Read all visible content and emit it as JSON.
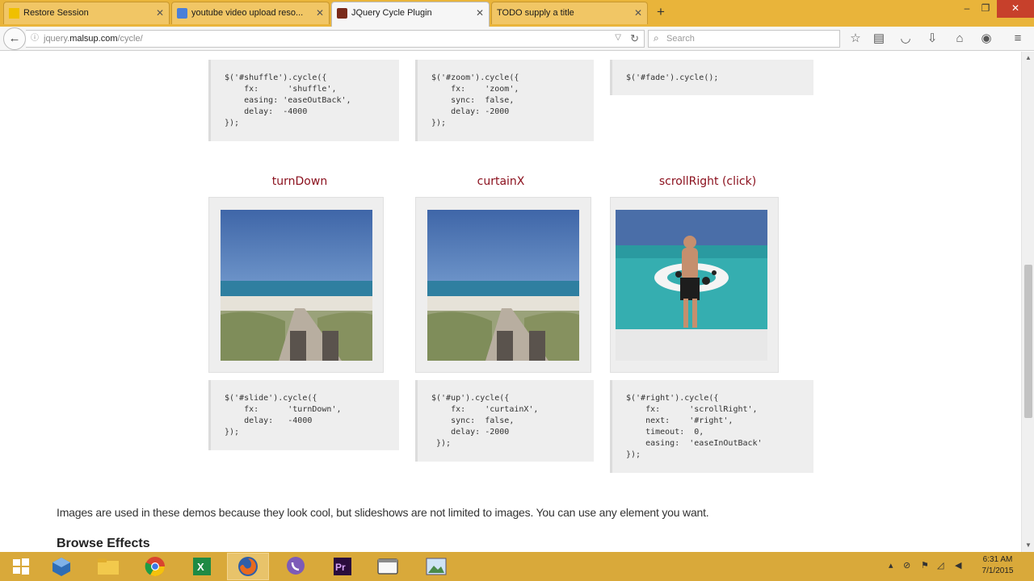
{
  "tabs": [
    {
      "label": "Restore Session",
      "icon": "warning-icon"
    },
    {
      "label": "youtube video upload reso...",
      "icon": "google-icon"
    },
    {
      "label": "JQuery Cycle Plugin",
      "icon": "page-icon"
    },
    {
      "label": "TODO supply a title",
      "icon": "blank-icon"
    }
  ],
  "nav": {
    "url_prefix": "jquery.",
    "url_domain": "malsup.com",
    "url_path": "/cycle/",
    "search_placeholder": "Search"
  },
  "top_code": [
    {
      "selector": "$('#shuffle').cycle({",
      "lines": [
        "    fx:      'shuffle',",
        "    easing: 'easeOutBack',",
        "    delay:  -4000",
        "});"
      ]
    },
    {
      "selector": "$('#zoom').cycle({",
      "lines": [
        "    fx:    'zoom',",
        "    sync:  false,",
        "    delay: -2000",
        "});"
      ]
    },
    {
      "selector": "$('#fade').cycle();",
      "lines": []
    }
  ],
  "demos": [
    {
      "title": "turnDown",
      "code": [
        "$('#slide').cycle({",
        "    fx:      'turnDown',",
        "    delay:   -4000",
        "});"
      ]
    },
    {
      "title": "curtainX",
      "code": [
        "$('#up').cycle({",
        "    fx:    'curtainX',",
        "    sync:  false,",
        "    delay: -2000",
        " });"
      ]
    },
    {
      "title": "scrollRight (click)",
      "code": [
        "$('#right').cycle({",
        "    fx:      'scrollRight',",
        "    next:    '#right',",
        "    timeout:  0,",
        "    easing:  'easeInOutBack'",
        "});"
      ]
    }
  ],
  "content": {
    "paragraph": "Images are used in these demos because they look cool, but slideshows are not limited to images.  You can use any element you want.",
    "heading": "Browse Effects"
  },
  "taskbar": {
    "apps": [
      "start-icon",
      "virtualbox-icon",
      "file-explorer-icon",
      "chrome-icon",
      "excel-icon",
      "firefox-icon",
      "viber-icon",
      "premiere-icon",
      "window-icon",
      "photos-icon"
    ],
    "time": "6:31 AM",
    "date": "7/1/2015"
  }
}
